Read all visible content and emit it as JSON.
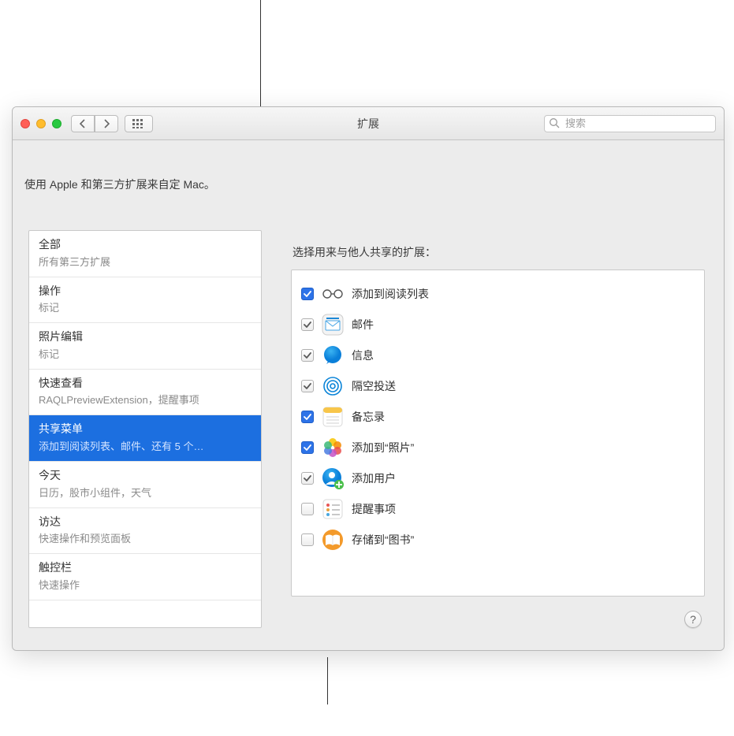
{
  "window": {
    "title": "扩展",
    "search_placeholder": "搜索",
    "intro": "使用 Apple 和第三方扩展来自定 Mac。",
    "help_label": "?"
  },
  "sidebar": {
    "items": [
      {
        "title": "全部",
        "sub": "所有第三方扩展"
      },
      {
        "title": "操作",
        "sub": "标记"
      },
      {
        "title": "照片编辑",
        "sub": "标记"
      },
      {
        "title": "快速查看",
        "sub": "RAQLPreviewExtension，提醒事项"
      },
      {
        "title": "共享菜单",
        "sub": "添加到阅读列表、邮件、还有 5 个…",
        "selected": true
      },
      {
        "title": "今天",
        "sub": "日历，股市小组件，天气"
      },
      {
        "title": "访达",
        "sub": "快速操作和预览面板"
      },
      {
        "title": "触控栏",
        "sub": "快速操作"
      }
    ]
  },
  "main": {
    "heading": "选择用来与他人共享的扩展：",
    "items": [
      {
        "label": "添加到阅读列表",
        "checked": true,
        "filled": true,
        "icon": "glasses"
      },
      {
        "label": "邮件",
        "checked": true,
        "filled": false,
        "icon": "mail"
      },
      {
        "label": "信息",
        "checked": true,
        "filled": false,
        "icon": "messages"
      },
      {
        "label": "隔空投送",
        "checked": true,
        "filled": false,
        "icon": "airdrop"
      },
      {
        "label": "备忘录",
        "checked": true,
        "filled": true,
        "icon": "notes"
      },
      {
        "label": "添加到“照片”",
        "checked": true,
        "filled": true,
        "icon": "photos"
      },
      {
        "label": "添加用户",
        "checked": true,
        "filled": false,
        "icon": "adduser"
      },
      {
        "label": "提醒事项",
        "checked": false,
        "filled": false,
        "icon": "reminders"
      },
      {
        "label": "存储到“图书”",
        "checked": false,
        "filled": false,
        "icon": "books"
      }
    ]
  }
}
